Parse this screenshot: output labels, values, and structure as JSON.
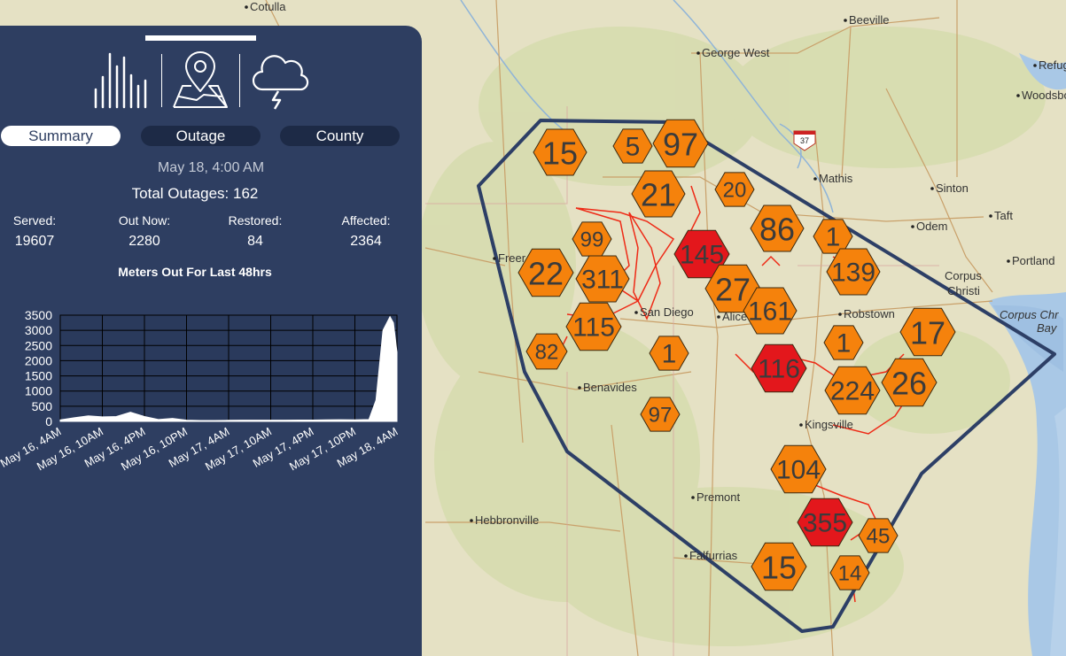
{
  "panel": {
    "tabs": {
      "chart_icon": "bar-chart-icon",
      "map_icon": "map-pin-icon",
      "weather_icon": "storm-cloud-icon"
    },
    "segments": {
      "summary": "Summary",
      "outage": "Outage",
      "county": "County"
    },
    "date": "May 18, 4:00 AM",
    "total_outages": "Total Outages: 162",
    "stats": [
      {
        "label": "Served:",
        "value": "19607"
      },
      {
        "label": "Out Now:",
        "value": "2280"
      },
      {
        "label": "Restored:",
        "value": "84"
      },
      {
        "label": "Affected:",
        "value": "2364"
      }
    ],
    "chart_title": "Meters Out For Last 48hrs"
  },
  "chart_data": {
    "type": "area",
    "title": "Meters Out For Last 48hrs",
    "ylim": [
      0,
      3500
    ],
    "yticks": [
      "3500",
      "3000",
      "2500",
      "2000",
      "1500",
      "1000",
      "500",
      "0"
    ],
    "xticks": [
      "May 16, 4AM",
      "May 16, 10AM",
      "May 16, 4PM",
      "May 16, 10PM",
      "May 17, 4AM",
      "May 17, 10AM",
      "May 17, 4PM",
      "May 17, 10PM",
      "May 18, 4AM"
    ],
    "x_hours": [
      0,
      2,
      4,
      6,
      8,
      10,
      12,
      14,
      16,
      18,
      20,
      22,
      24,
      26,
      28,
      30,
      32,
      34,
      36,
      38,
      40,
      42,
      44,
      45,
      46,
      47,
      47.5,
      48
    ],
    "values": [
      50,
      120,
      180,
      150,
      160,
      300,
      160,
      60,
      100,
      40,
      30,
      30,
      35,
      40,
      40,
      40,
      40,
      45,
      45,
      50,
      55,
      50,
      60,
      700,
      3000,
      3450,
      3250,
      2280
    ],
    "fill": "#ffffff",
    "grid": true
  },
  "map": {
    "places": [
      "Cotulla",
      "George West",
      "Beeville",
      "Mathis",
      "Sinton",
      "Taft",
      "Odem",
      "Portland",
      "Corpus Christi",
      "Corpus Christi Bay",
      "San Diego",
      "Alice",
      "Robstown",
      "Kingsville",
      "Benavides",
      "Premont",
      "Falfurrias",
      "Hebbronville",
      "Refugio",
      "Woodsboro",
      "Freer"
    ],
    "highway_shield": "37",
    "clusters": [
      {
        "label": "15",
        "color": "#f5820c"
      },
      {
        "label": "5",
        "color": "#f5820c"
      },
      {
        "label": "97",
        "color": "#f5820c"
      },
      {
        "label": "21",
        "color": "#f5820c"
      },
      {
        "label": "20",
        "color": "#f5820c"
      },
      {
        "label": "99",
        "color": "#f5820c"
      },
      {
        "label": "145",
        "color": "#e3171c"
      },
      {
        "label": "86",
        "color": "#f5820c"
      },
      {
        "label": "1",
        "color": "#f5820c"
      },
      {
        "label": "22",
        "color": "#f5820c"
      },
      {
        "label": "311",
        "color": "#f5820c"
      },
      {
        "label": "139",
        "color": "#f5820c"
      },
      {
        "label": "27",
        "color": "#f5820c"
      },
      {
        "label": "161",
        "color": "#f5820c"
      },
      {
        "label": "115",
        "color": "#f5820c"
      },
      {
        "label": "82",
        "color": "#f5820c"
      },
      {
        "label": "1",
        "color": "#f5820c"
      },
      {
        "label": "1",
        "color": "#f5820c"
      },
      {
        "label": "17",
        "color": "#f5820c"
      },
      {
        "label": "116",
        "color": "#e3171c"
      },
      {
        "label": "224",
        "color": "#f5820c"
      },
      {
        "label": "26",
        "color": "#f5820c"
      },
      {
        "label": "97",
        "color": "#f5820c"
      },
      {
        "label": "104",
        "color": "#f5820c"
      },
      {
        "label": "355",
        "color": "#e3171c"
      },
      {
        "label": "45",
        "color": "#f5820c"
      },
      {
        "label": "15",
        "color": "#f5820c"
      },
      {
        "label": "14",
        "color": "#f5820c"
      }
    ]
  }
}
